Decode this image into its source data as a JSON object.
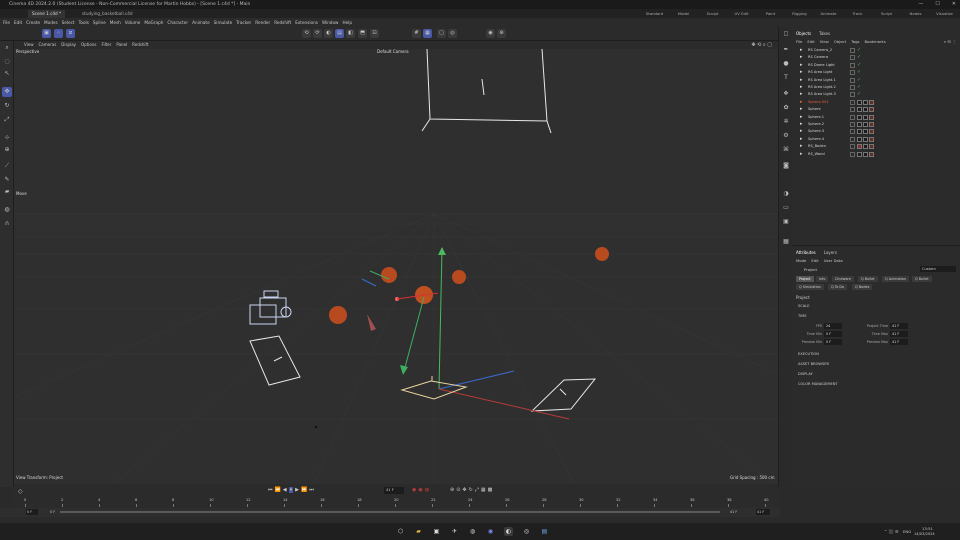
{
  "window": {
    "title": "Cinema 4D 2024.2.0 (Student License - Non-Commercial License for Martin Hobbs) - [Scene 1.c4d *] - Main",
    "min": "—",
    "max": "☐",
    "close": "✕"
  },
  "file_tabs": [
    "Scene 1.c4d *",
    "studying_basketball.c4d"
  ],
  "layouts": [
    "Standard",
    "Model",
    "Sculpt",
    "UV Edit",
    "Paint",
    "Rigging",
    "Animate",
    "Track",
    "Script",
    "Nodes",
    "Visualize"
  ],
  "menu": [
    "File",
    "Edit",
    "Create",
    "Modes",
    "Select",
    "Tools",
    "Spline",
    "Mesh",
    "Volume",
    "MoGraph",
    "Character",
    "Animate",
    "Simulate",
    "Tracker",
    "Render",
    "Redshift",
    "Extensions",
    "Window",
    "Help"
  ],
  "viewport_menu": [
    "View",
    "Cameras",
    "Display",
    "Options",
    "Filter",
    "Panel",
    "Redshift"
  ],
  "viewport": {
    "name": "Perspective",
    "camera": "Default Camera",
    "move_label": "Move",
    "status": "View Transform: Project",
    "grid": "Grid Spacing : 500 cm"
  },
  "objects_panel": {
    "tabs": [
      "Objects",
      "Takes"
    ],
    "menu": [
      "File",
      "Edit",
      "View",
      "Object",
      "Tags",
      "Bookmarks"
    ],
    "items": [
      {
        "name": "RS Camera_2",
        "color": "#d4d4d4",
        "tag": "tick"
      },
      {
        "name": "RS Camera",
        "color": "#d4d4d4",
        "tag": "tick"
      },
      {
        "name": "RS Dome Light",
        "color": "#d4d4d4",
        "tag": "tick"
      },
      {
        "name": "RS Area Light",
        "color": "#d4d4d4",
        "tag": "tick"
      },
      {
        "name": "RS Area Light.1",
        "color": "#d4d4d4",
        "tag": "tick"
      },
      {
        "name": "RS Area Light.2",
        "color": "#d4d4d4",
        "tag": "tick"
      },
      {
        "name": "RS Area Light.3",
        "color": "#d4d4d4",
        "tag": "tick"
      },
      {
        "name": "Sphere.001",
        "color": "#e06040",
        "tag": "mat"
      },
      {
        "name": "Sphere",
        "color": "#d4d4d4",
        "tag": "mat"
      },
      {
        "name": "Sphere.1",
        "color": "#d4d4d4",
        "tag": "mat"
      },
      {
        "name": "Sphere.2",
        "color": "#d4d4d4",
        "tag": "mat"
      },
      {
        "name": "Sphere.3",
        "color": "#d4d4d4",
        "tag": "mat"
      },
      {
        "name": "Sphere.4",
        "color": "#d4d4d4",
        "tag": "mat"
      },
      {
        "name": "RS_Boden",
        "color": "#d4d4d4",
        "tag": "x"
      },
      {
        "name": "RS_Wand",
        "color": "#d4d4d4",
        "tag": "mat"
      }
    ]
  },
  "attributes_panel": {
    "tabs": [
      "Attributes",
      "Layers"
    ],
    "menu": [
      "Mode",
      "Edit",
      "User Data"
    ],
    "header": "Project",
    "preset": "Custom",
    "buttons": [
      "Project",
      "Info",
      "Cineware",
      "Q Bullet",
      "Q Animation",
      "Q Bullet",
      "Q Simulation",
      "Q To Do",
      "Q Nodes"
    ],
    "section_title": "Project",
    "scale": "SCALE",
    "time": "TIME",
    "fields": [
      {
        "label": "FPS",
        "value": "24"
      },
      {
        "label": "Project Time",
        "value": "41 F"
      },
      {
        "label": "Time Min",
        "value": "0 F"
      },
      {
        "label": "Time Max",
        "value": "41 F"
      },
      {
        "label": "Preview Min",
        "value": "0 F"
      },
      {
        "label": "Preview Max",
        "value": "41 F"
      }
    ],
    "collapsed": [
      "EXECUTION",
      "ASSET BROWSER",
      "DISPLAY",
      "COLOR MANAGEMENT"
    ]
  },
  "timeline": {
    "current": "41 F",
    "ticks": [
      "0",
      "2",
      "4",
      "6",
      "8",
      "10",
      "12",
      "14",
      "16",
      "18",
      "20",
      "22",
      "24",
      "26",
      "28",
      "30",
      "32",
      "34",
      "36",
      "38",
      "40"
    ],
    "start": "0 F",
    "start2": "0 F",
    "end": "41 F",
    "end2": "41 F"
  },
  "taskbar": {
    "lang": "ENG",
    "time": "13:51",
    "date": "14/03/2024"
  }
}
